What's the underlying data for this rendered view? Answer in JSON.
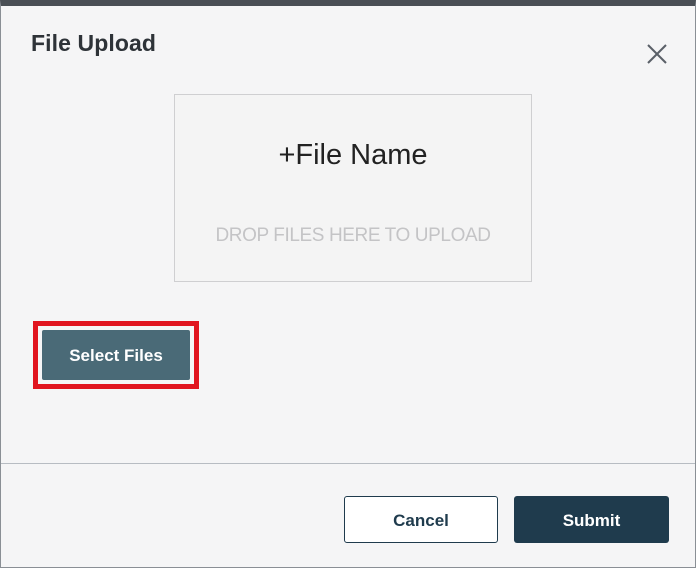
{
  "dialog": {
    "title": "File Upload",
    "close_icon": "close-icon"
  },
  "drop_zone": {
    "file_name": "+File Name",
    "hint": "DROP FILES HERE TO UPLOAD"
  },
  "actions": {
    "select_files_label": "Select Files",
    "cancel_label": "Cancel",
    "submit_label": "Submit"
  },
  "colors": {
    "select_files_bg": "#4a6a77",
    "primary": "#1f3b4d",
    "highlight": "#e1151f",
    "dialog_bg": "#f5f5f6"
  }
}
